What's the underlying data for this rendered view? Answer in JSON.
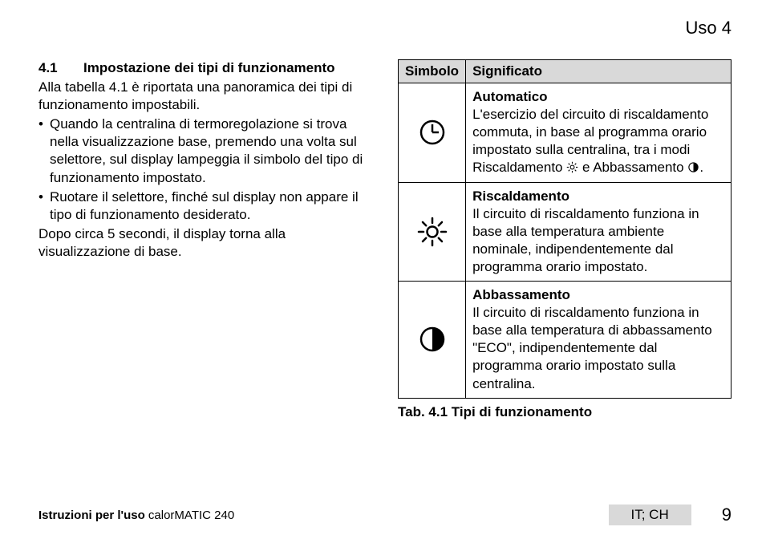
{
  "header": {
    "right": "Uso 4"
  },
  "section": {
    "num": "4.1",
    "title": "Impostazione dei tipi di funzionamento",
    "intro": "Alla tabella 4.1 è riportata una panoramica dei tipi di funzionamento impostabili.",
    "bullets": [
      "Quando la centralina di termoregolazione si trova nella visualizzazione base, premendo una volta sul selettore, sul display lampeggia il simbolo del tipo di funzionamento impostato.",
      "Ruotare il selettore, finché sul display non appare il tipo di funzionamento desiderato."
    ],
    "after": "Dopo circa 5 secondi, il display torna alla visualizzazione di base."
  },
  "table": {
    "col1": "Simbolo",
    "col2": "Significato",
    "rows": [
      {
        "title": "Automatico",
        "text1": "L'esercizio del circuito di riscaldamento commuta, in base al programma orario impostato sulla centralina, tra i modi Riscaldamento ",
        "text2": " e Abbassamento ",
        "text3": "."
      },
      {
        "title": "Riscaldamento",
        "text1": "Il circuito di riscaldamento funziona in base alla temperatura ambiente nominale, indipendentemente dal programma orario impostato."
      },
      {
        "title": "Abbassamento",
        "text1": "Il circuito di riscaldamento funziona in base alla temperatura di abbassamento \"ECO\", indipendentemente dal programma orario impostato sulla centralina."
      }
    ],
    "caption": "Tab. 4.1 Tipi di funzionamento"
  },
  "footer": {
    "leftBold": "Istruzioni per l'uso",
    "leftNormal": " calorMATIC 240",
    "tag": "IT; CH",
    "pagenum": "9"
  }
}
